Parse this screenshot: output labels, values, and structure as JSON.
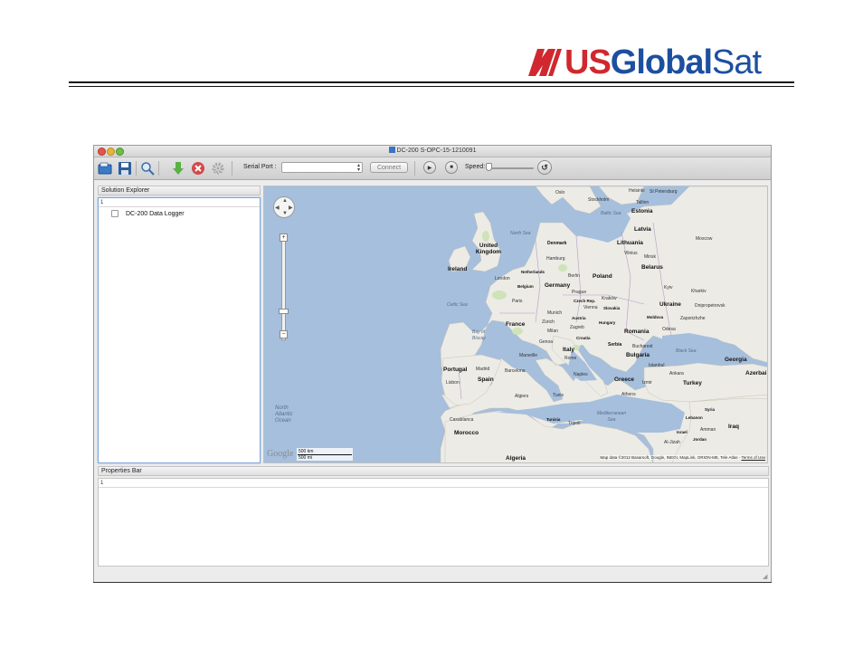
{
  "logo": {
    "part1": "US",
    "part2": "Global",
    "part3": "Sat"
  },
  "window": {
    "title": "DC-200 S-OPC-15-1210091"
  },
  "toolbar": {
    "serial_port_label": "Serial Port :",
    "serial_port_value": "",
    "connect_label": "Connect",
    "speed_label": "Speed:"
  },
  "solution_explorer": {
    "title": "Solution Explorer",
    "header": "1",
    "items": [
      {
        "label": "DC-200 Data Logger"
      }
    ]
  },
  "properties_bar": {
    "title": "Properties Bar",
    "header": "1"
  },
  "map": {
    "countries": [
      "Estonia",
      "Latvia",
      "Lithuania",
      "Belarus",
      "Poland",
      "Germany",
      "Netherlands",
      "Belgium",
      "Denmark",
      "United Kingdom",
      "Ireland",
      "France",
      "Czech Rep.",
      "Slovakia",
      "Austria",
      "Hungary",
      "Moldova",
      "Ukraine",
      "Romania",
      "Croatia",
      "Serbia",
      "Italy",
      "Bulgaria",
      "Georgia",
      "Portugal",
      "Spain",
      "Greece",
      "Turkey",
      "Azerbai",
      "Syria",
      "Lebanon",
      "Israel",
      "Jordan",
      "Iraq",
      "Tunisia",
      "Morocco",
      "Algeria"
    ],
    "cities": [
      "Oslo",
      "Stockholm",
      "Helsinki",
      "St Petersburg",
      "Tallinn",
      "Moscow",
      "Vilnius",
      "Minsk",
      "Hamburg",
      "Berlin",
      "London",
      "Paris",
      "Prague",
      "Kraków",
      "Vienna",
      "Munich",
      "Zürich",
      "Milan",
      "Zagreb",
      "Kyiv",
      "Kharkiv",
      "Dnipropetrovsk",
      "Zaporizhzhe",
      "Odesa",
      "Bucharest",
      "Istanbul",
      "Ankara",
      "Izmir",
      "Athens",
      "Naples",
      "Rome",
      "Madrid",
      "Barcelona",
      "Lisbon",
      "Marseille",
      "Algiers",
      "Tunis",
      "Tripoli",
      "Casablanca",
      "Amman",
      "Al-Jizah",
      "Genoa"
    ],
    "seas": [
      "North Sea",
      "Baltic Sea",
      "Celtic Sea",
      "Bay of Biscay",
      "Black Sea",
      "Mediterranean Sea",
      "North Atlantic Ocean"
    ],
    "scale_km": "500 km",
    "scale_mi": "500 mi",
    "google_label": "Google",
    "attribution": "Map data ©2012 Basarsoft, Google, INEGI, MapLink, ORION-ME, Tele Atlas -",
    "terms": "Terms of Use"
  },
  "icons": [
    "open-icon",
    "save-icon",
    "search-icon",
    "download-icon",
    "delete-icon",
    "settings-icon",
    "play-icon",
    "stop-icon",
    "reset-icon"
  ],
  "colors": {
    "brand_red": "#d0282e",
    "brand_blue": "#1d4fa0",
    "sea": "#a5bfdd",
    "land": "#ecebe6",
    "selection": "#7ea7d8"
  }
}
